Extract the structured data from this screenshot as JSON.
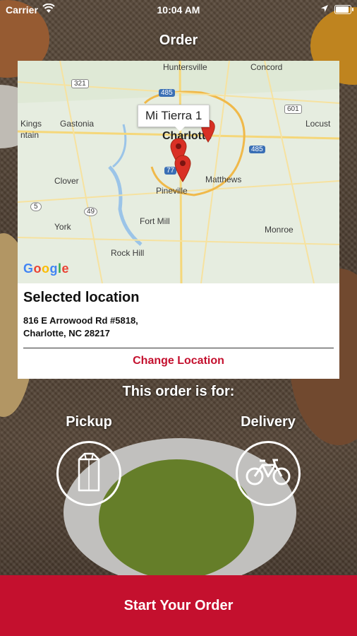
{
  "status": {
    "carrier": "Carrier",
    "time": "10:04 AM"
  },
  "header": {
    "title": "Order"
  },
  "map": {
    "callout": "Mi Tierra 1",
    "labels": {
      "huntersville": "Huntersville",
      "concord": "Concord",
      "kings": "Kings",
      "mountain": "ntain",
      "gastonia": "Gastonia",
      "charlotte": "Charlotte",
      "locust": "Locust",
      "matthews": "Matthews",
      "clover": "Clover",
      "pineville": "Pineville",
      "york": "York",
      "fort_mill": "Fort Mill",
      "monroe": "Monroe",
      "rock_hill": "Rock Hill",
      "s485": "485",
      "s485b": "485",
      "s321": "321",
      "s601": "601",
      "s77": "77",
      "s5": "5",
      "s49": "49"
    },
    "google_logo": "Google"
  },
  "location": {
    "heading": "Selected location",
    "address_line1": "816 E Arrowood Rd #5818,",
    "address_line2": "Charlotte, NC 28217",
    "change_label": "Change Location"
  },
  "order_for": {
    "heading": "This order is for:",
    "pickup_label": "Pickup",
    "delivery_label": "Delivery"
  },
  "cta": {
    "label": "Start Your Order"
  },
  "colors": {
    "accent": "#c4102e",
    "map_bg": "#e8eee3"
  }
}
